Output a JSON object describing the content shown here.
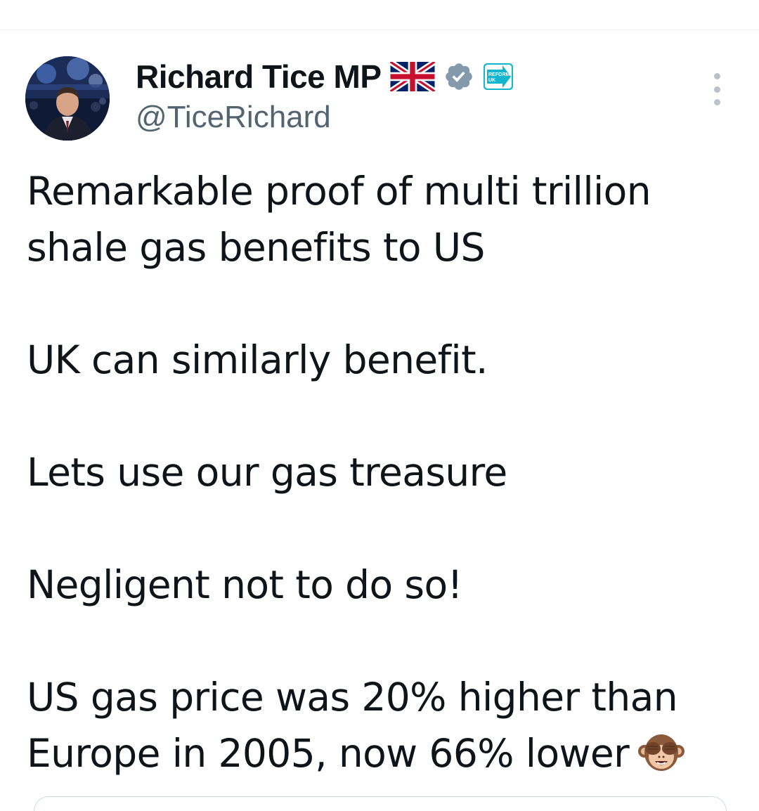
{
  "tweet": {
    "author": {
      "display_name": "Richard Tice MP",
      "handle": "@TiceRichard",
      "avatar": "profile-photo",
      "badges": [
        "uk-flag-icon",
        "verified-badge-icon",
        "reform-uk-logo-icon"
      ],
      "reform_logo_text": "REFORM UK"
    },
    "body": {
      "p1_line1": "Remarkable proof of multi trillion",
      "p1_line2": "shale gas benefits to US",
      "p2": "UK can similarly benefit.",
      "p3": "Lets use our gas treasure",
      "p4": "Negligent not to do so!",
      "p5_line1": "US gas price was 20% higher than",
      "p5_line2": "Europe in 2005, now 66% lower",
      "emoji": "see-no-evil-monkey-emoji"
    }
  },
  "colors": {
    "text": "#0f1419",
    "secondary": "#536471",
    "verified_badge": "#829aab",
    "reform_blue": "#12b6cf"
  }
}
